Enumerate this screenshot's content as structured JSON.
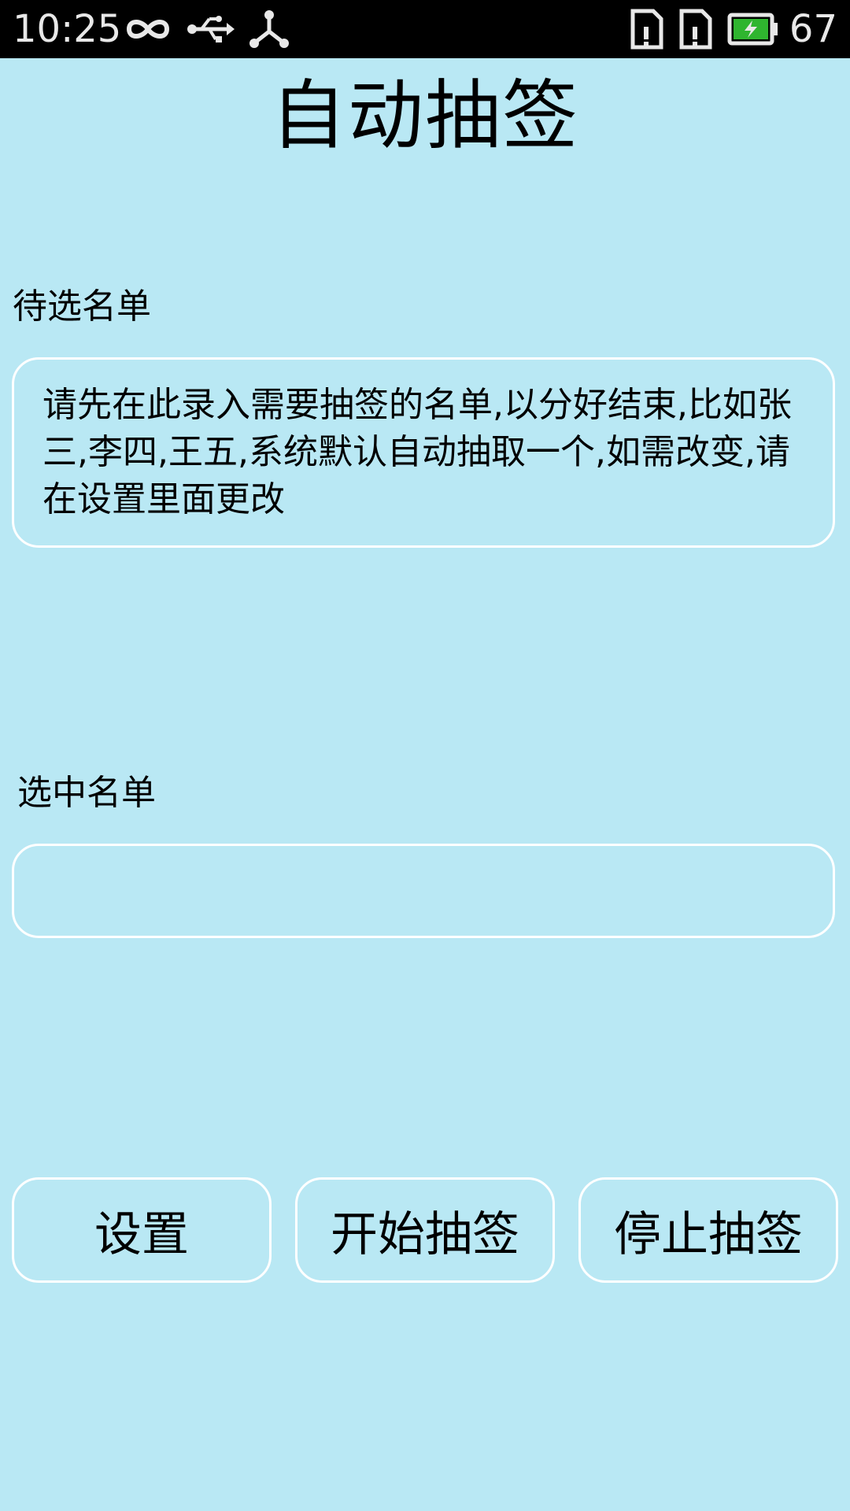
{
  "status_bar": {
    "time": "10:25",
    "battery": "67",
    "icons": [
      "infinity-icon",
      "usb-icon",
      "share-icon",
      "sim-card-icon",
      "sim-card-icon",
      "battery-charging-icon"
    ]
  },
  "app": {
    "title": "自动抽签"
  },
  "candidates": {
    "label": "待选名单",
    "placeholder": "请先在此录入需要抽签的名单,以分好结束,比如张三,李四,王五,系统默认自动抽取一个,如需改变,请在设置里面更改"
  },
  "selected": {
    "label": "选中名单",
    "value": ""
  },
  "buttons": {
    "settings": "设置",
    "start": "开始抽签",
    "stop": "停止抽签"
  },
  "colors": {
    "background": "#b9e8f4",
    "border": "#ffffff",
    "status_bar": "#000000",
    "battery_fill": "#2fb52f"
  }
}
